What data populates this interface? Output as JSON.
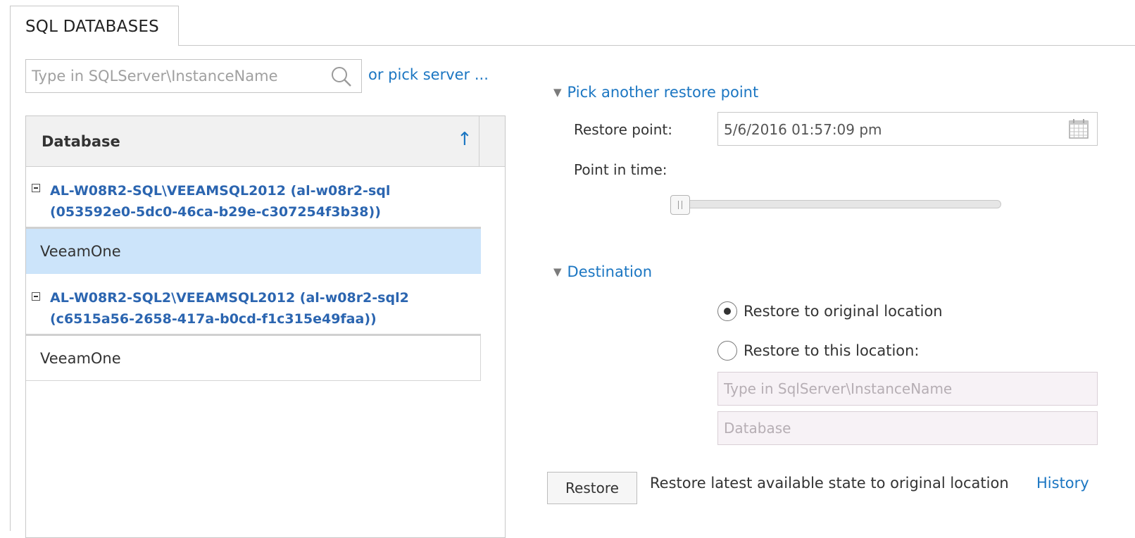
{
  "tab": {
    "label": "SQL DATABASES"
  },
  "search": {
    "placeholder": "Type in SQLServer\\InstanceName",
    "value": ""
  },
  "pick_server_link": "or pick server ...",
  "grid": {
    "column_header": "Database",
    "sort_indicator": "↑",
    "groups": [
      {
        "title": "AL-W08R2-SQL\\VEEAMSQL2012 (al-w08r2-sql (053592e0-5dc0-46ca-b29e-c307254f3b38))",
        "databases": [
          {
            "name": "VeeamOne",
            "selected": true
          }
        ]
      },
      {
        "title": "AL-W08R2-SQL2\\VEEAMSQL2012 (al-w08r2-sql2 (c6515a56-2658-417a-b0cd-f1c315e49faa))",
        "databases": [
          {
            "name": "VeeamOne",
            "selected": false
          }
        ]
      }
    ]
  },
  "restore_point_section": {
    "header": "Pick another restore point",
    "restore_point_label": "Restore point:",
    "restore_point_value": "5/6/2016 01:57:09 pm",
    "point_in_time_label": "Point in time:",
    "slider_position": 0
  },
  "destination_section": {
    "header": "Destination",
    "option_original": "Restore to original location",
    "option_this": "Restore to this location:",
    "selected_option": "original",
    "server_placeholder": "Type in SqlServer\\InstanceName",
    "database_placeholder": "Database"
  },
  "footer": {
    "restore_button": "Restore",
    "description": "Restore latest available state to original location",
    "history_link": "History"
  },
  "colors": {
    "link": "#1b76c2",
    "group_title": "#2b65b0",
    "selected_row": "#cce4fa",
    "header_bg": "#f1f1f1"
  }
}
